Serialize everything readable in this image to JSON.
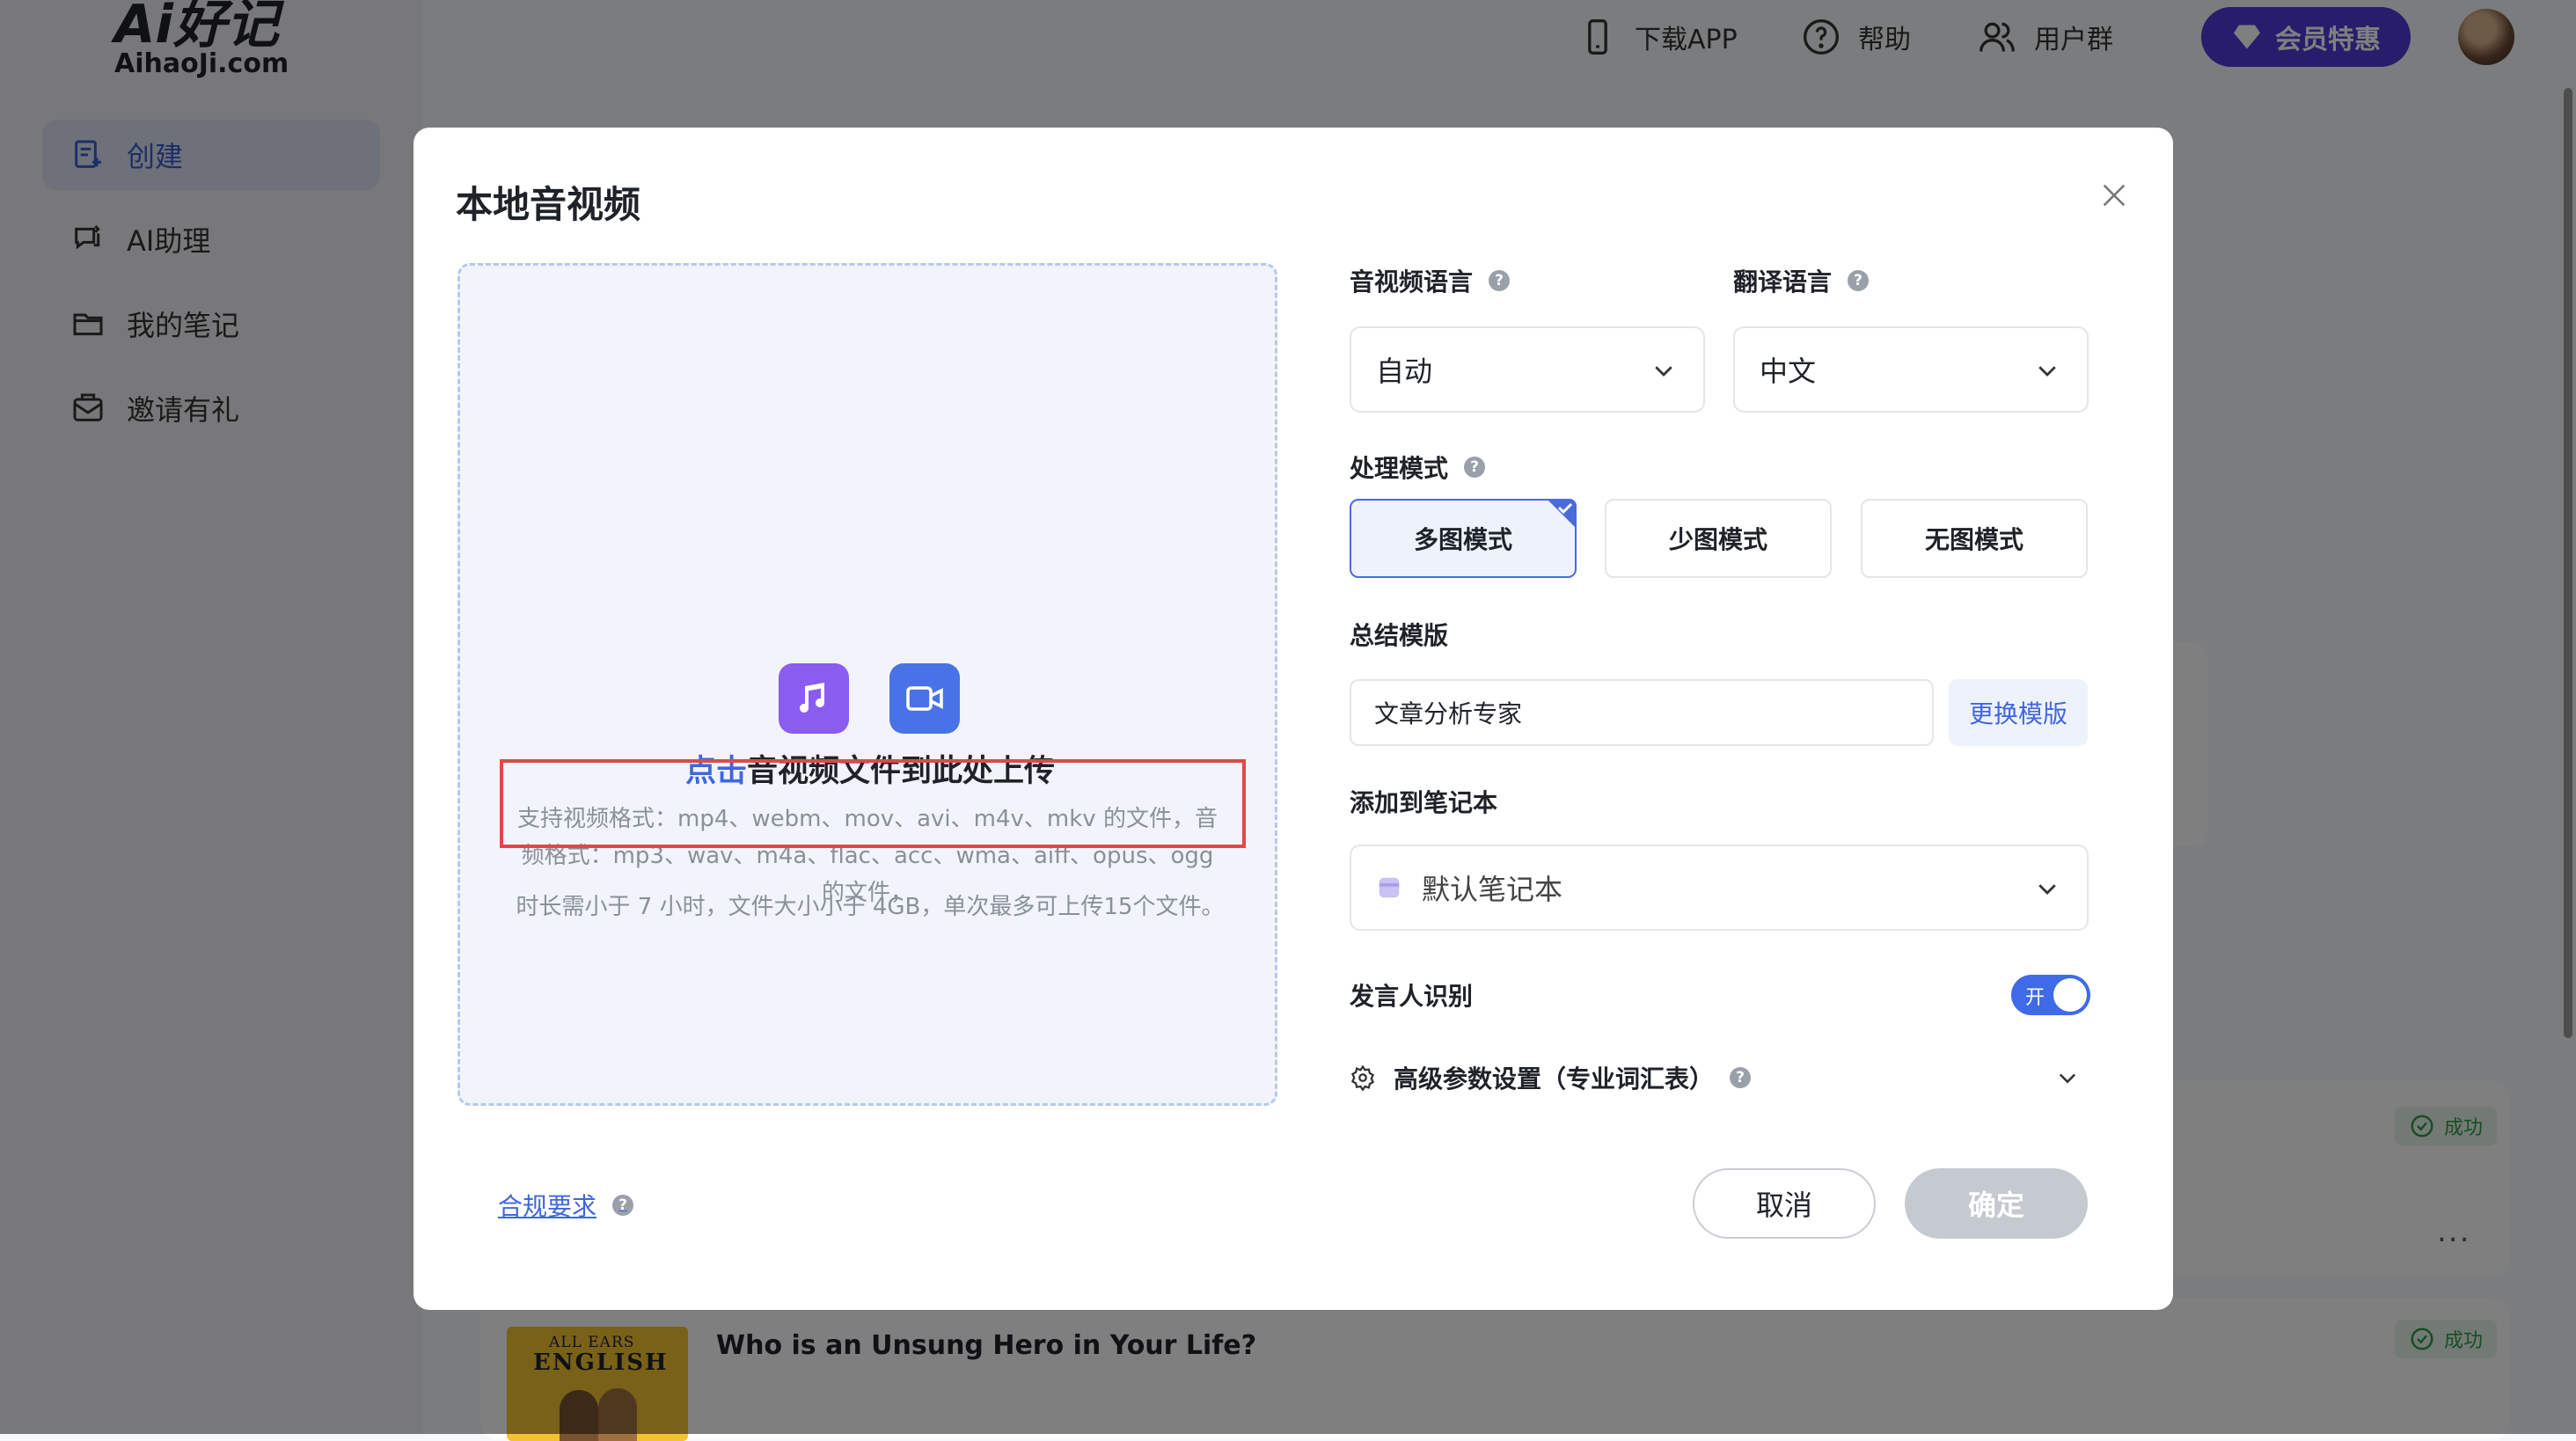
{
  "app": {
    "logo_main": "Ai好记",
    "logo_sub": "AihaoJi.com"
  },
  "sidebar": {
    "items": [
      {
        "label": "创建",
        "icon": "create-note-icon",
        "active": true
      },
      {
        "label": "AI助理",
        "icon": "chat-refresh-icon",
        "active": false
      },
      {
        "label": "我的笔记",
        "icon": "folder-icon",
        "active": false
      },
      {
        "label": "邀请有礼",
        "icon": "mail-gift-icon",
        "active": false
      }
    ]
  },
  "topbar": {
    "download_app": "下载APP",
    "help": "帮助",
    "user_group": "用户群",
    "vip": "会员特惠"
  },
  "background_list": {
    "status_label": "成功",
    "item_title": "Who is an Unsung Hero in Your Life?",
    "cover_line1": "ALL EARS",
    "cover_line2": "ENGLISH",
    "more": "..."
  },
  "modal": {
    "title": "本地音视频",
    "upload": {
      "link_text": "点击",
      "title_rest": "音视频文件到此处上传",
      "formats_text": "支持视频格式：mp4、webm、mov、avi、m4v、mkv 的文件，音频格式：mp3、wav、m4a、flac、acc、wma、aiff、opus、ogg 的文件，",
      "limit_text": "时长需小于 7 小时，文件大小小于 4GB，单次最多可上传15个文件。"
    },
    "audio_language": {
      "label": "音视频语言",
      "value": "自动"
    },
    "translate_language": {
      "label": "翻译语言",
      "value": "中文"
    },
    "process_mode": {
      "label": "处理模式",
      "options": [
        "多图模式",
        "少图模式",
        "无图模式"
      ],
      "selected_index": 0
    },
    "summary_template": {
      "label": "总结模版",
      "value": "文章分析专家",
      "change_button": "更换模版"
    },
    "notebook": {
      "label": "添加到笔记本",
      "value": "默认笔记本"
    },
    "speaker_recognition": {
      "label": "发言人识别",
      "toggle_label": "开",
      "enabled": true
    },
    "advanced": {
      "label": "高级参数设置（专业词汇表）"
    },
    "compliance_link": "合规要求",
    "cancel_button": "取消",
    "confirm_button": "确定"
  },
  "colors": {
    "accent": "#3f66e0",
    "vip": "#4c3bd9",
    "highlight_border": "#e04848",
    "success": "#2e9a4b"
  }
}
